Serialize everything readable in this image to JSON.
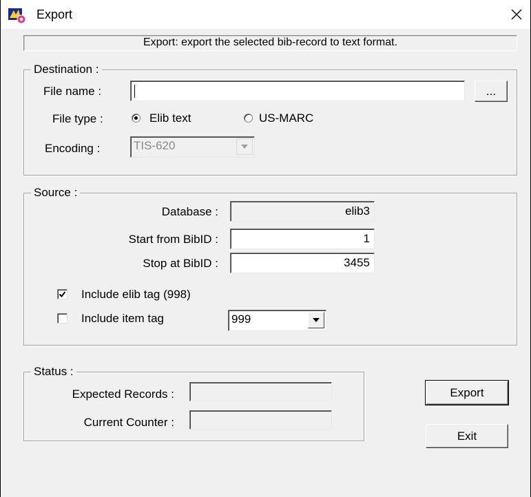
{
  "window": {
    "title": "Export",
    "app_icon": "elib-app-icon",
    "close_icon": "close-icon"
  },
  "description": "Export: export the selected bib-record to text format.",
  "destination": {
    "legend": "Destination :",
    "file_name_label": "File name :",
    "file_name_value": "",
    "browse_label": "...",
    "file_type_label": "File type :",
    "file_type_options": [
      {
        "label": "Elib text",
        "selected": true
      },
      {
        "label": "US-MARC",
        "selected": false
      }
    ],
    "encoding_label": "Encoding :",
    "encoding_value": "TIS-620",
    "encoding_disabled": true
  },
  "source": {
    "legend": "Source :",
    "database_label": "Database :",
    "database_value": "elib3",
    "start_label": "Start from BibID :",
    "start_value": "1",
    "stop_label": "Stop at BibID :",
    "stop_value": "3455",
    "include_elib_label": "Include elib tag (998)",
    "include_elib_checked": true,
    "include_item_label": "Include item tag",
    "include_item_checked": false,
    "item_tag_value": "999"
  },
  "status": {
    "legend": "Status :",
    "expected_label": "Expected Records :",
    "expected_value": "",
    "counter_label": "Current Counter :",
    "counter_value": ""
  },
  "buttons": {
    "export_label": "Export",
    "exit_label": "Exit"
  }
}
